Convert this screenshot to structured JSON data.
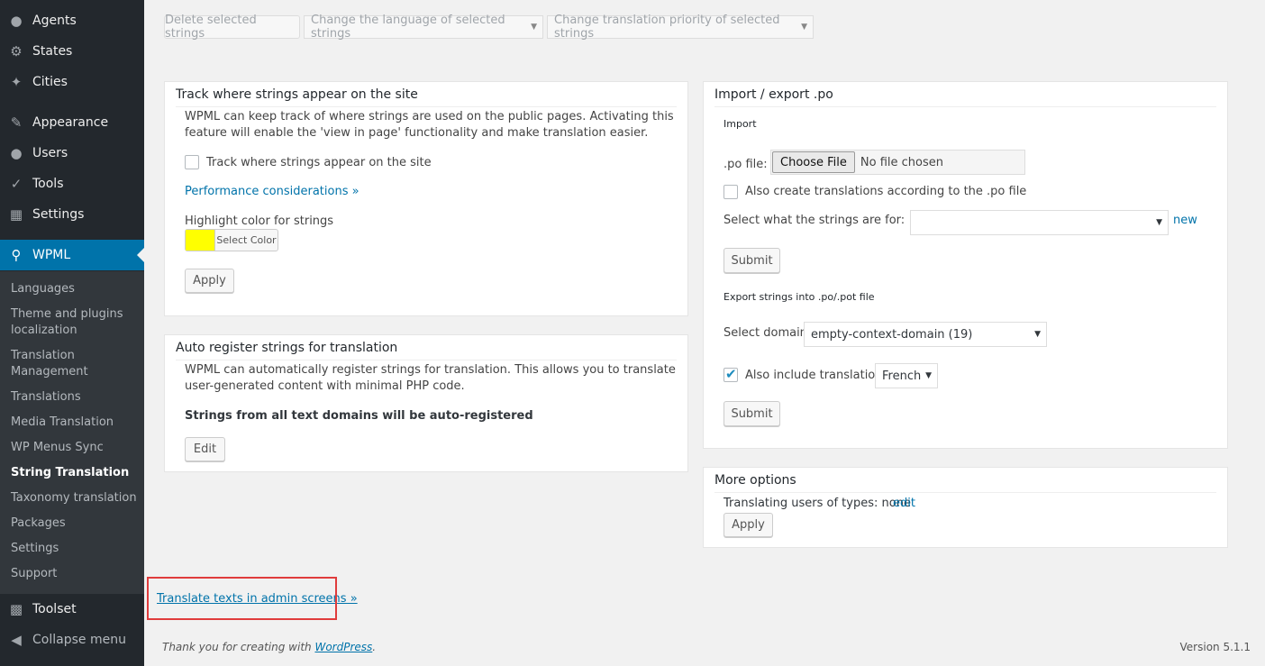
{
  "sidebar": {
    "top_items": [
      {
        "label": "Agents",
        "icon": "person-icon"
      },
      {
        "label": "States",
        "icon": "gear-icon"
      },
      {
        "label": "Cities",
        "icon": "pin-icon"
      },
      {
        "label": "Appearance",
        "icon": "paintbrush-icon"
      },
      {
        "label": "Users",
        "icon": "users-icon"
      },
      {
        "label": "Tools",
        "icon": "wrench-icon"
      },
      {
        "label": "Settings",
        "icon": "settings-icon"
      }
    ],
    "active_item": {
      "label": "WPML",
      "icon": "wpml-icon"
    },
    "submenu": [
      {
        "label": "Languages"
      },
      {
        "label": "Theme and plugins localization"
      },
      {
        "label": "Translation Management"
      },
      {
        "label": "Translations"
      },
      {
        "label": "Media Translation"
      },
      {
        "label": "WP Menus Sync"
      },
      {
        "label": "String Translation"
      },
      {
        "label": "Taxonomy translation"
      },
      {
        "label": "Packages"
      },
      {
        "label": "Settings"
      },
      {
        "label": "Support"
      }
    ],
    "bottom_items": [
      {
        "label": "Toolset",
        "icon": "toolset-icon"
      },
      {
        "label": "Collapse menu",
        "icon": "collapse-icon"
      }
    ]
  },
  "bulk_actions": {
    "delete_label": "Delete selected strings",
    "change_language_label": "Change the language of selected strings",
    "change_priority_label": "Change translation priority of selected strings"
  },
  "track_box": {
    "title": "Track where strings appear on the site",
    "description_line1": "WPML can keep track of where strings are used on the public pages. Activating this",
    "description_line2": "feature will enable the 'view in page' functionality and make translation easier.",
    "checkbox_label": "Track where strings appear on the site",
    "performance_link": "Performance considerations »",
    "highlight_label": "Highlight color for strings",
    "highlight_color": "#ffff00",
    "select_color_label": "Select Color",
    "apply_label": "Apply"
  },
  "auto_box": {
    "title": "Auto register strings for translation",
    "description_line1": "WPML can automatically register strings for translation. This allows you to translate",
    "description_line2": "user-generated content with minimal PHP code.",
    "status": "Strings from all text domains will be auto-registered",
    "edit_label": "Edit"
  },
  "import_box": {
    "title": "Import / export .po",
    "import_heading": "Import",
    "po_file_label": ".po file:",
    "choose_file_label": "Choose File",
    "no_file_label": "No file chosen",
    "also_create_label": "Also create translations according to the .po file",
    "select_for_label": "Select what the strings are for:",
    "select_for_value": "",
    "new_link": "new",
    "submit_label": "Submit",
    "export_heading": "Export strings into .po/.pot file",
    "select_domain_label": "Select domain:",
    "domain_value": "empty-context-domain (19)",
    "include_translations_label": "Also include translations",
    "language_value": "French",
    "export_submit_label": "Submit"
  },
  "more_box": {
    "title": "More options",
    "translating_users": "Translating users of types: none",
    "edit_link": "edit",
    "apply_label": "Apply"
  },
  "footer": {
    "admin_link": "Translate texts in admin screens »",
    "thanks_prefix": "Thank you for creating with ",
    "wordpress_link": "WordPress",
    "thanks_suffix": ".",
    "version": "Version 5.1.1"
  },
  "colors": {
    "sidebar_bg": "#23282d",
    "submenu_bg": "#32373c",
    "accent": "#0073aa",
    "highlight_frame": "#e03c3c"
  }
}
